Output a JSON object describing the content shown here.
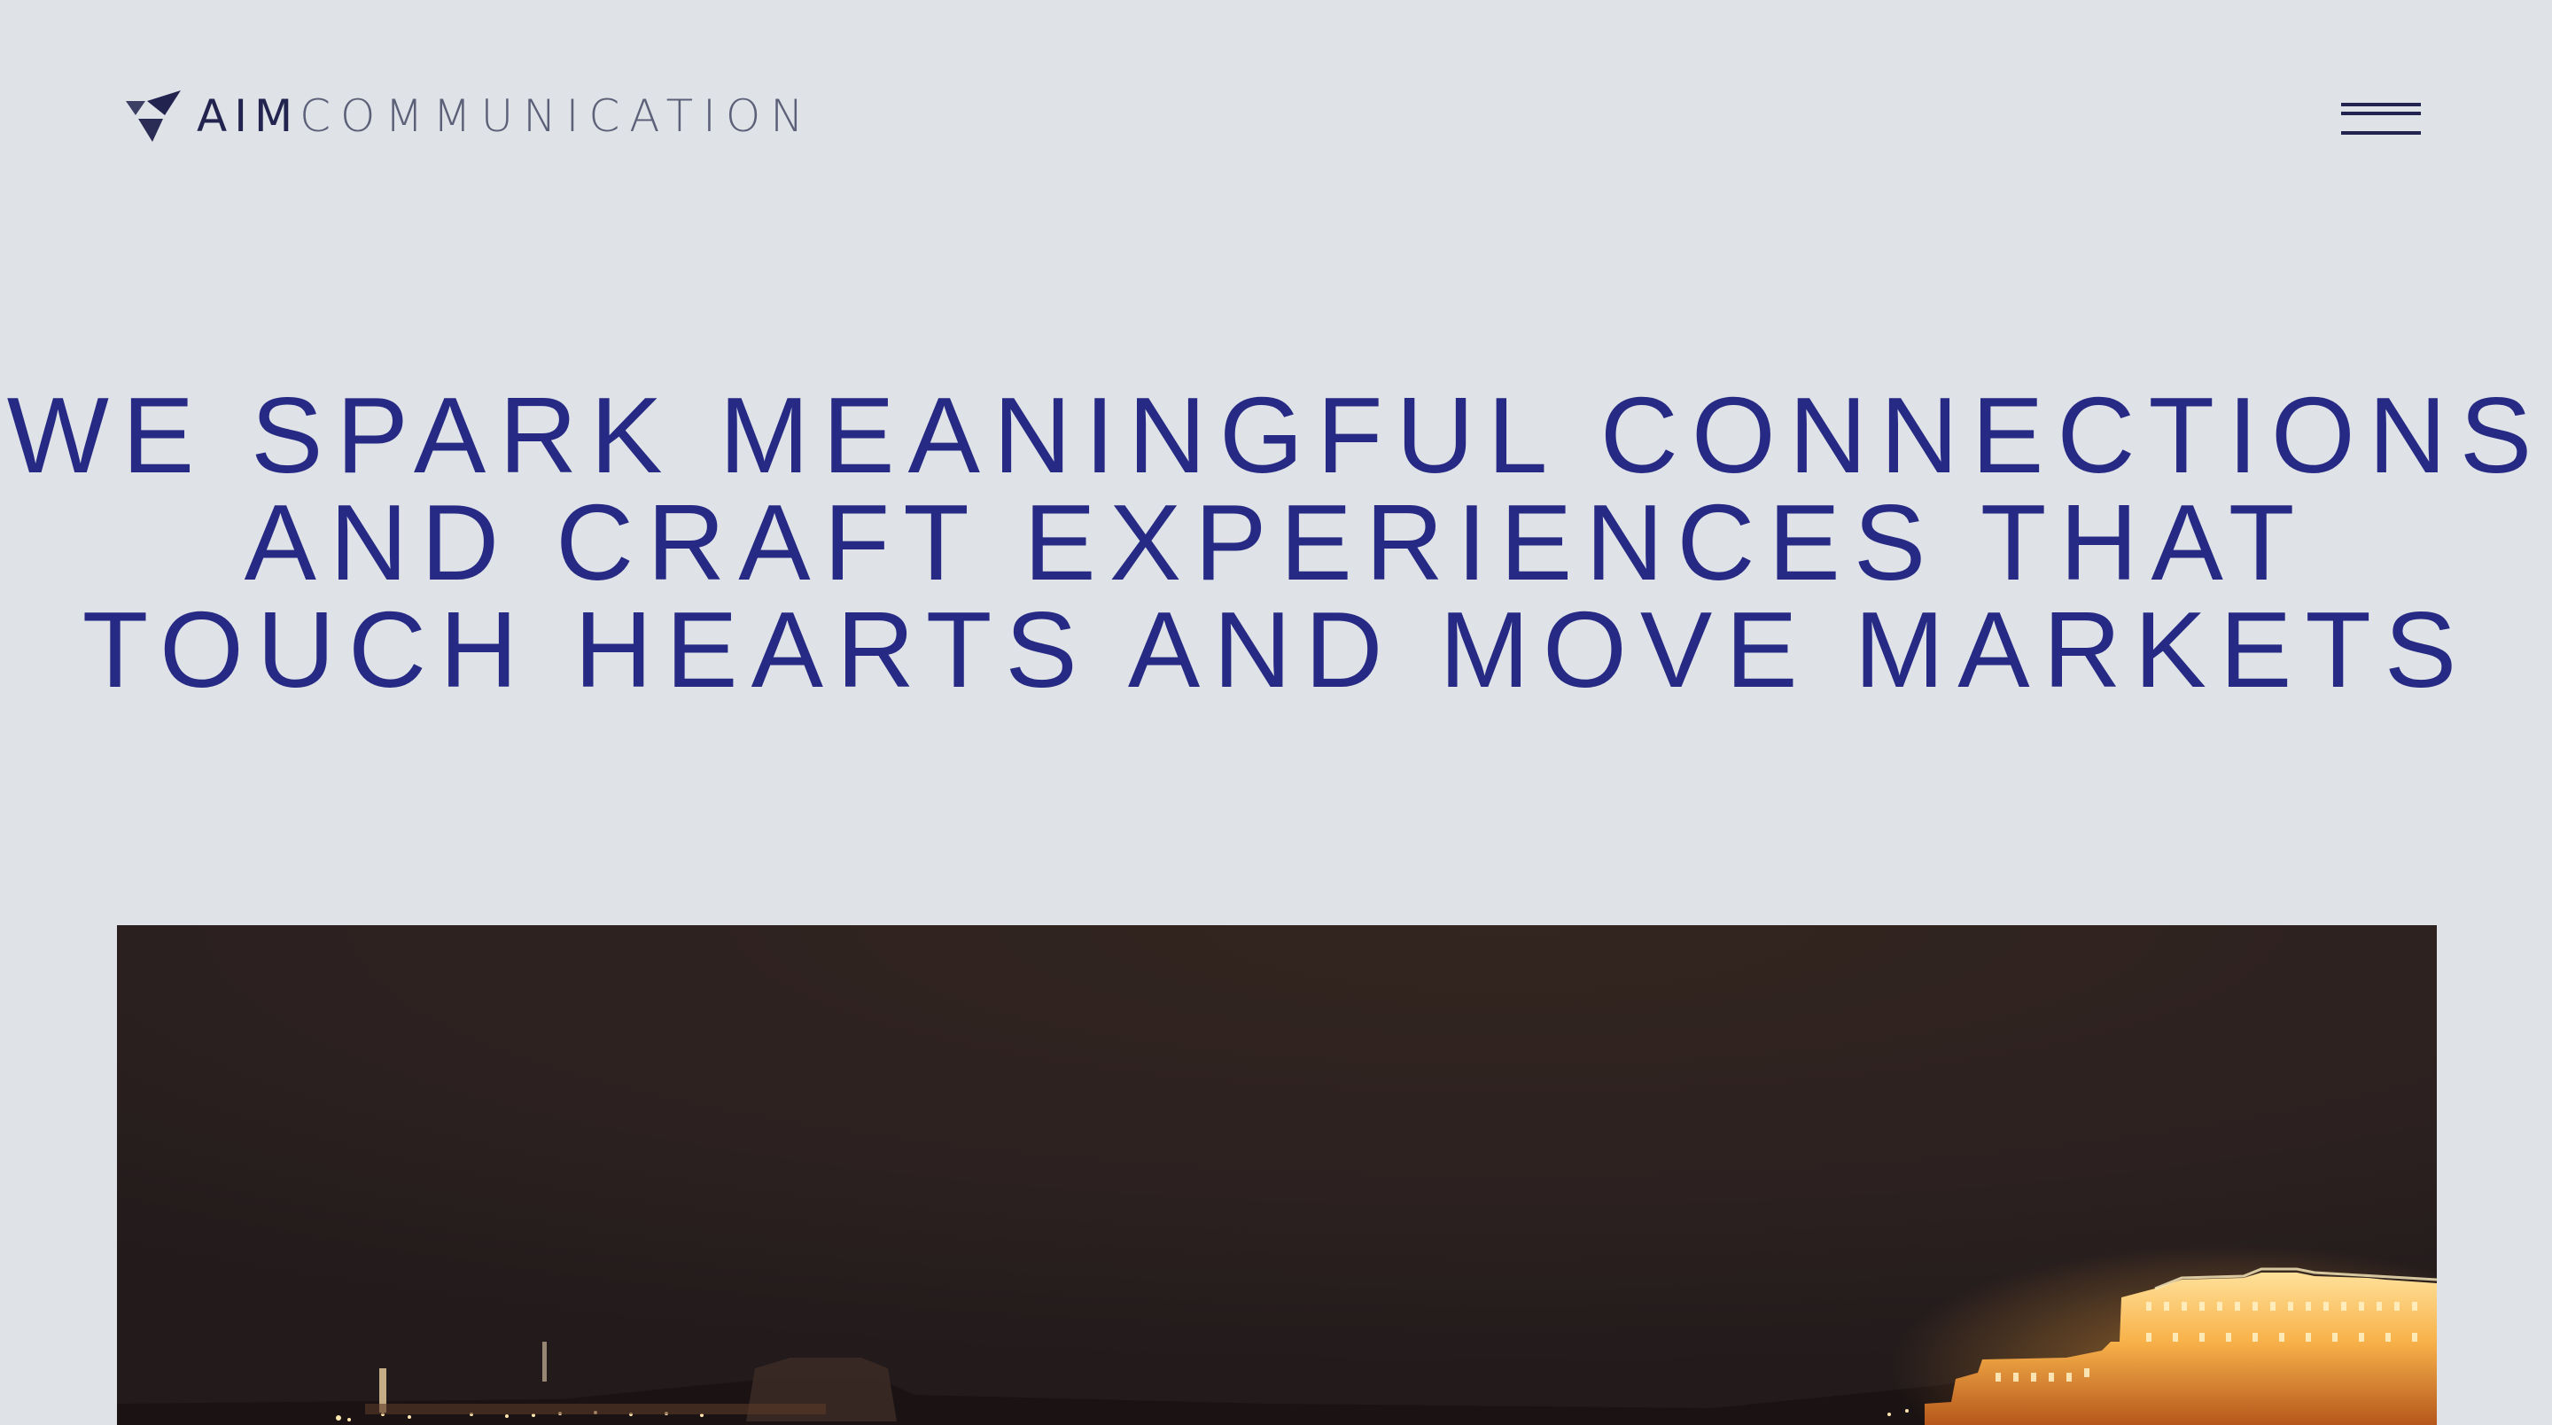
{
  "header": {
    "logo": {
      "brand_primary": "AIM",
      "brand_secondary": "COMMUNICATION",
      "icon": "aim-triangles-logo-icon"
    },
    "menu": {
      "icon": "hamburger-menu-icon"
    }
  },
  "hero": {
    "lines": [
      "WE SPARK MEANINGFUL CONNECTIONS",
      "AND CRAFT EXPERIENCES THAT",
      "TOUCH HEARTS AND MOVE MARKETS"
    ]
  },
  "media": {
    "scene": "night-city-castle-video",
    "colors": {
      "sky": "#2c2120",
      "lights": "#f4a23a",
      "highlight": "#ffd98a"
    }
  },
  "colors": {
    "background": "#dfe2e6",
    "brand_dark": "#22234f",
    "brand_muted": "#5c6079",
    "headline": "#262a84"
  }
}
